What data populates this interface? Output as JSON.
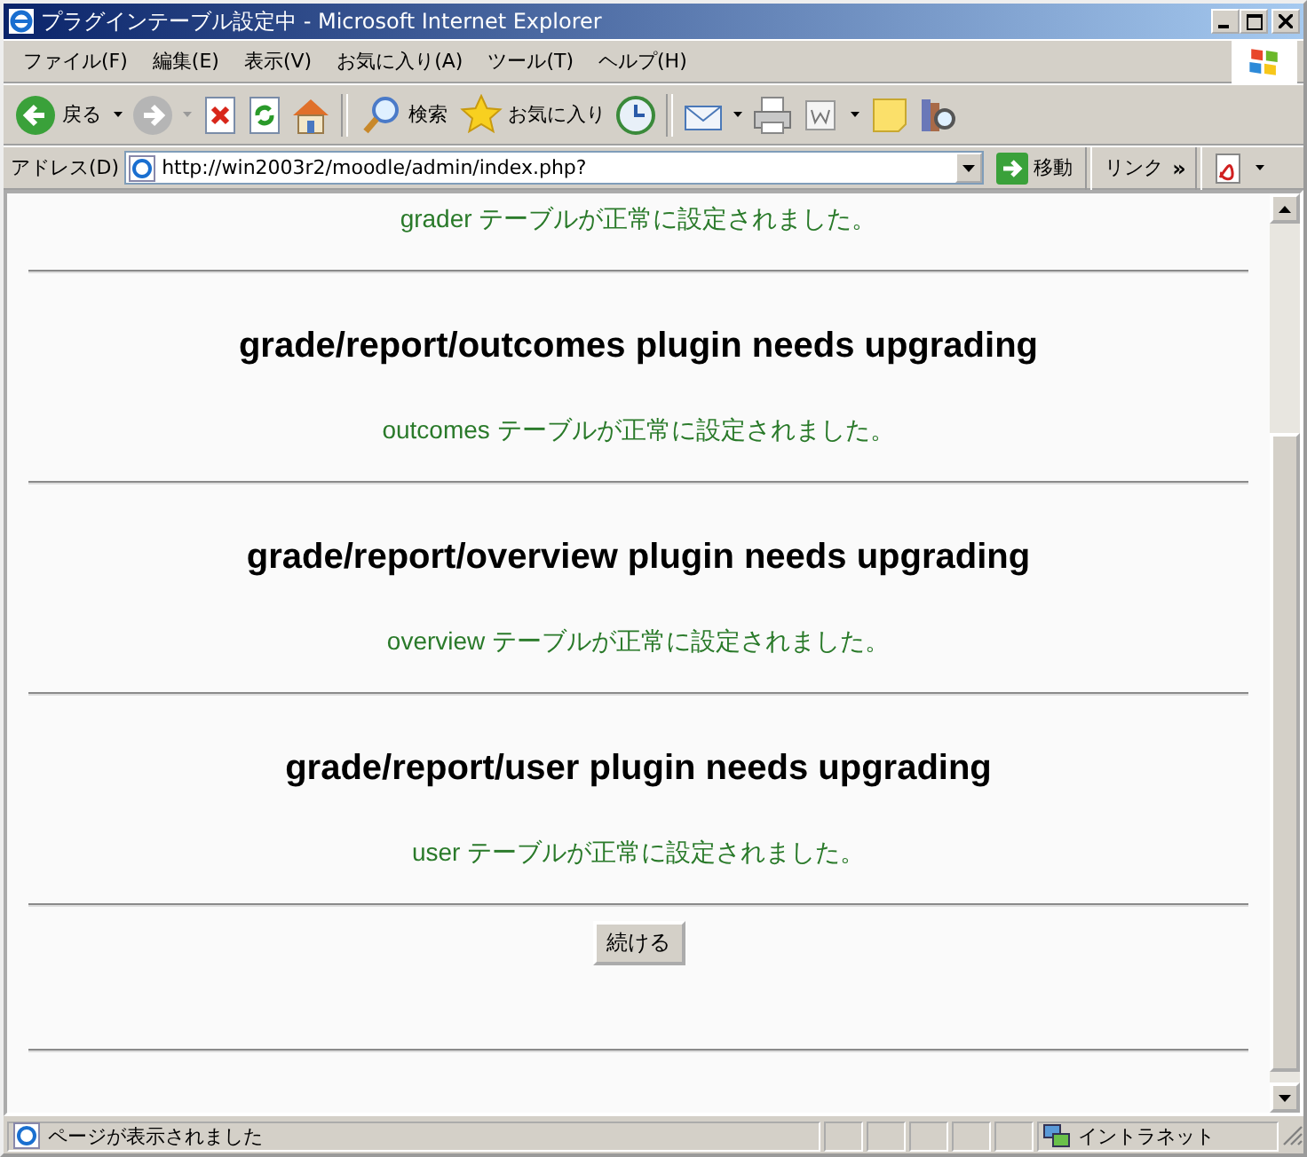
{
  "window": {
    "title": "プラグインテーブル設定中 - Microsoft Internet Explorer"
  },
  "menu": [
    "ファイル(F)",
    "編集(E)",
    "表示(V)",
    "お気に入り(A)",
    "ツール(T)",
    "ヘルプ(H)"
  ],
  "toolbar": {
    "back": "戻る",
    "search": "検索",
    "favorites": "お気に入り"
  },
  "address": {
    "label": "アドレス(D)",
    "value": "http://win2003r2/moodle/admin/index.php?",
    "go": "移動",
    "links": "リンク",
    "chevron": "»"
  },
  "sections": [
    {
      "message": "grader テーブルが正常に設定されました。"
    },
    {
      "heading": "grade/report/outcomes plugin needs upgrading",
      "message": "outcomes テーブルが正常に設定されました。"
    },
    {
      "heading": "grade/report/overview plugin needs upgrading",
      "message": "overview テーブルが正常に設定されました。"
    },
    {
      "heading": "grade/report/user plugin needs upgrading",
      "message": "user テーブルが正常に設定されました。"
    }
  ],
  "continue_button": "続ける",
  "status_bar": {
    "text": "ページが表示されました",
    "zone": "イントラネット"
  }
}
